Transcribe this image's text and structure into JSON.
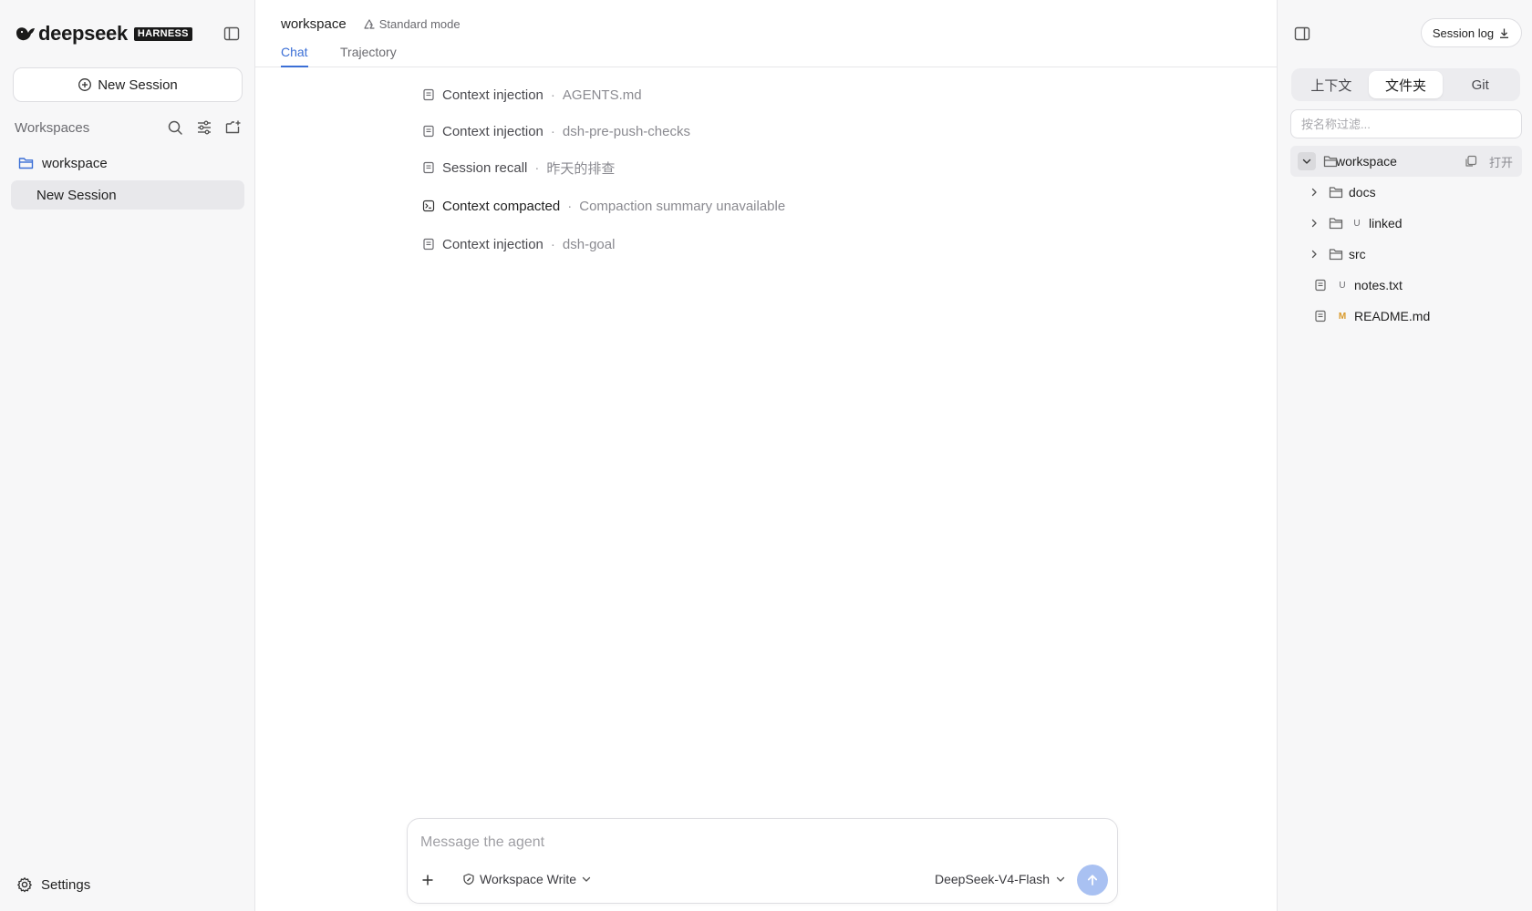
{
  "brand": {
    "name": "deepseek",
    "badge": "HARNESS"
  },
  "sidebar": {
    "new_session": "New Session",
    "workspaces_label": "Workspaces",
    "workspace_name": "workspace",
    "sessions": [
      "New Session"
    ],
    "settings": "Settings"
  },
  "main": {
    "title": "workspace",
    "mode": "Standard mode",
    "tabs": [
      "Chat",
      "Trajectory"
    ],
    "events": [
      {
        "kind": "Context injection",
        "detail": "AGENTS.md",
        "icon": "document-icon"
      },
      {
        "kind": "Context injection",
        "detail": "dsh-pre-push-checks",
        "icon": "document-icon"
      },
      {
        "kind": "Session recall",
        "detail": "昨天的排查",
        "icon": "document-icon"
      },
      {
        "kind": "Context compacted",
        "detail": "Compaction summary unavailable",
        "icon": "terminal-icon"
      },
      {
        "kind": "Context injection",
        "detail": "dsh-goal",
        "icon": "document-icon"
      }
    ],
    "composer": {
      "placeholder": "Message the agent",
      "permission": "Workspace Write",
      "model": "DeepSeek-V4-Flash"
    }
  },
  "right_panel": {
    "session_log": "Session log",
    "segments": [
      "上下文",
      "文件夹",
      "Git"
    ],
    "active_segment": "文件夹",
    "filter_placeholder": "按名称过滤...",
    "root": {
      "name": "workspace",
      "open": "打开"
    },
    "tree": [
      {
        "name": "docs",
        "type": "folder",
        "git": ""
      },
      {
        "name": "linked",
        "type": "folder",
        "git": "U"
      },
      {
        "name": "src",
        "type": "folder",
        "git": ""
      },
      {
        "name": "notes.txt",
        "type": "file",
        "git": "U"
      },
      {
        "name": "README.md",
        "type": "file",
        "git": "M"
      }
    ]
  },
  "colors": {
    "accent": "#3b6fd6",
    "send_button": "#a9c1f2",
    "modified": "#d99a2b"
  }
}
